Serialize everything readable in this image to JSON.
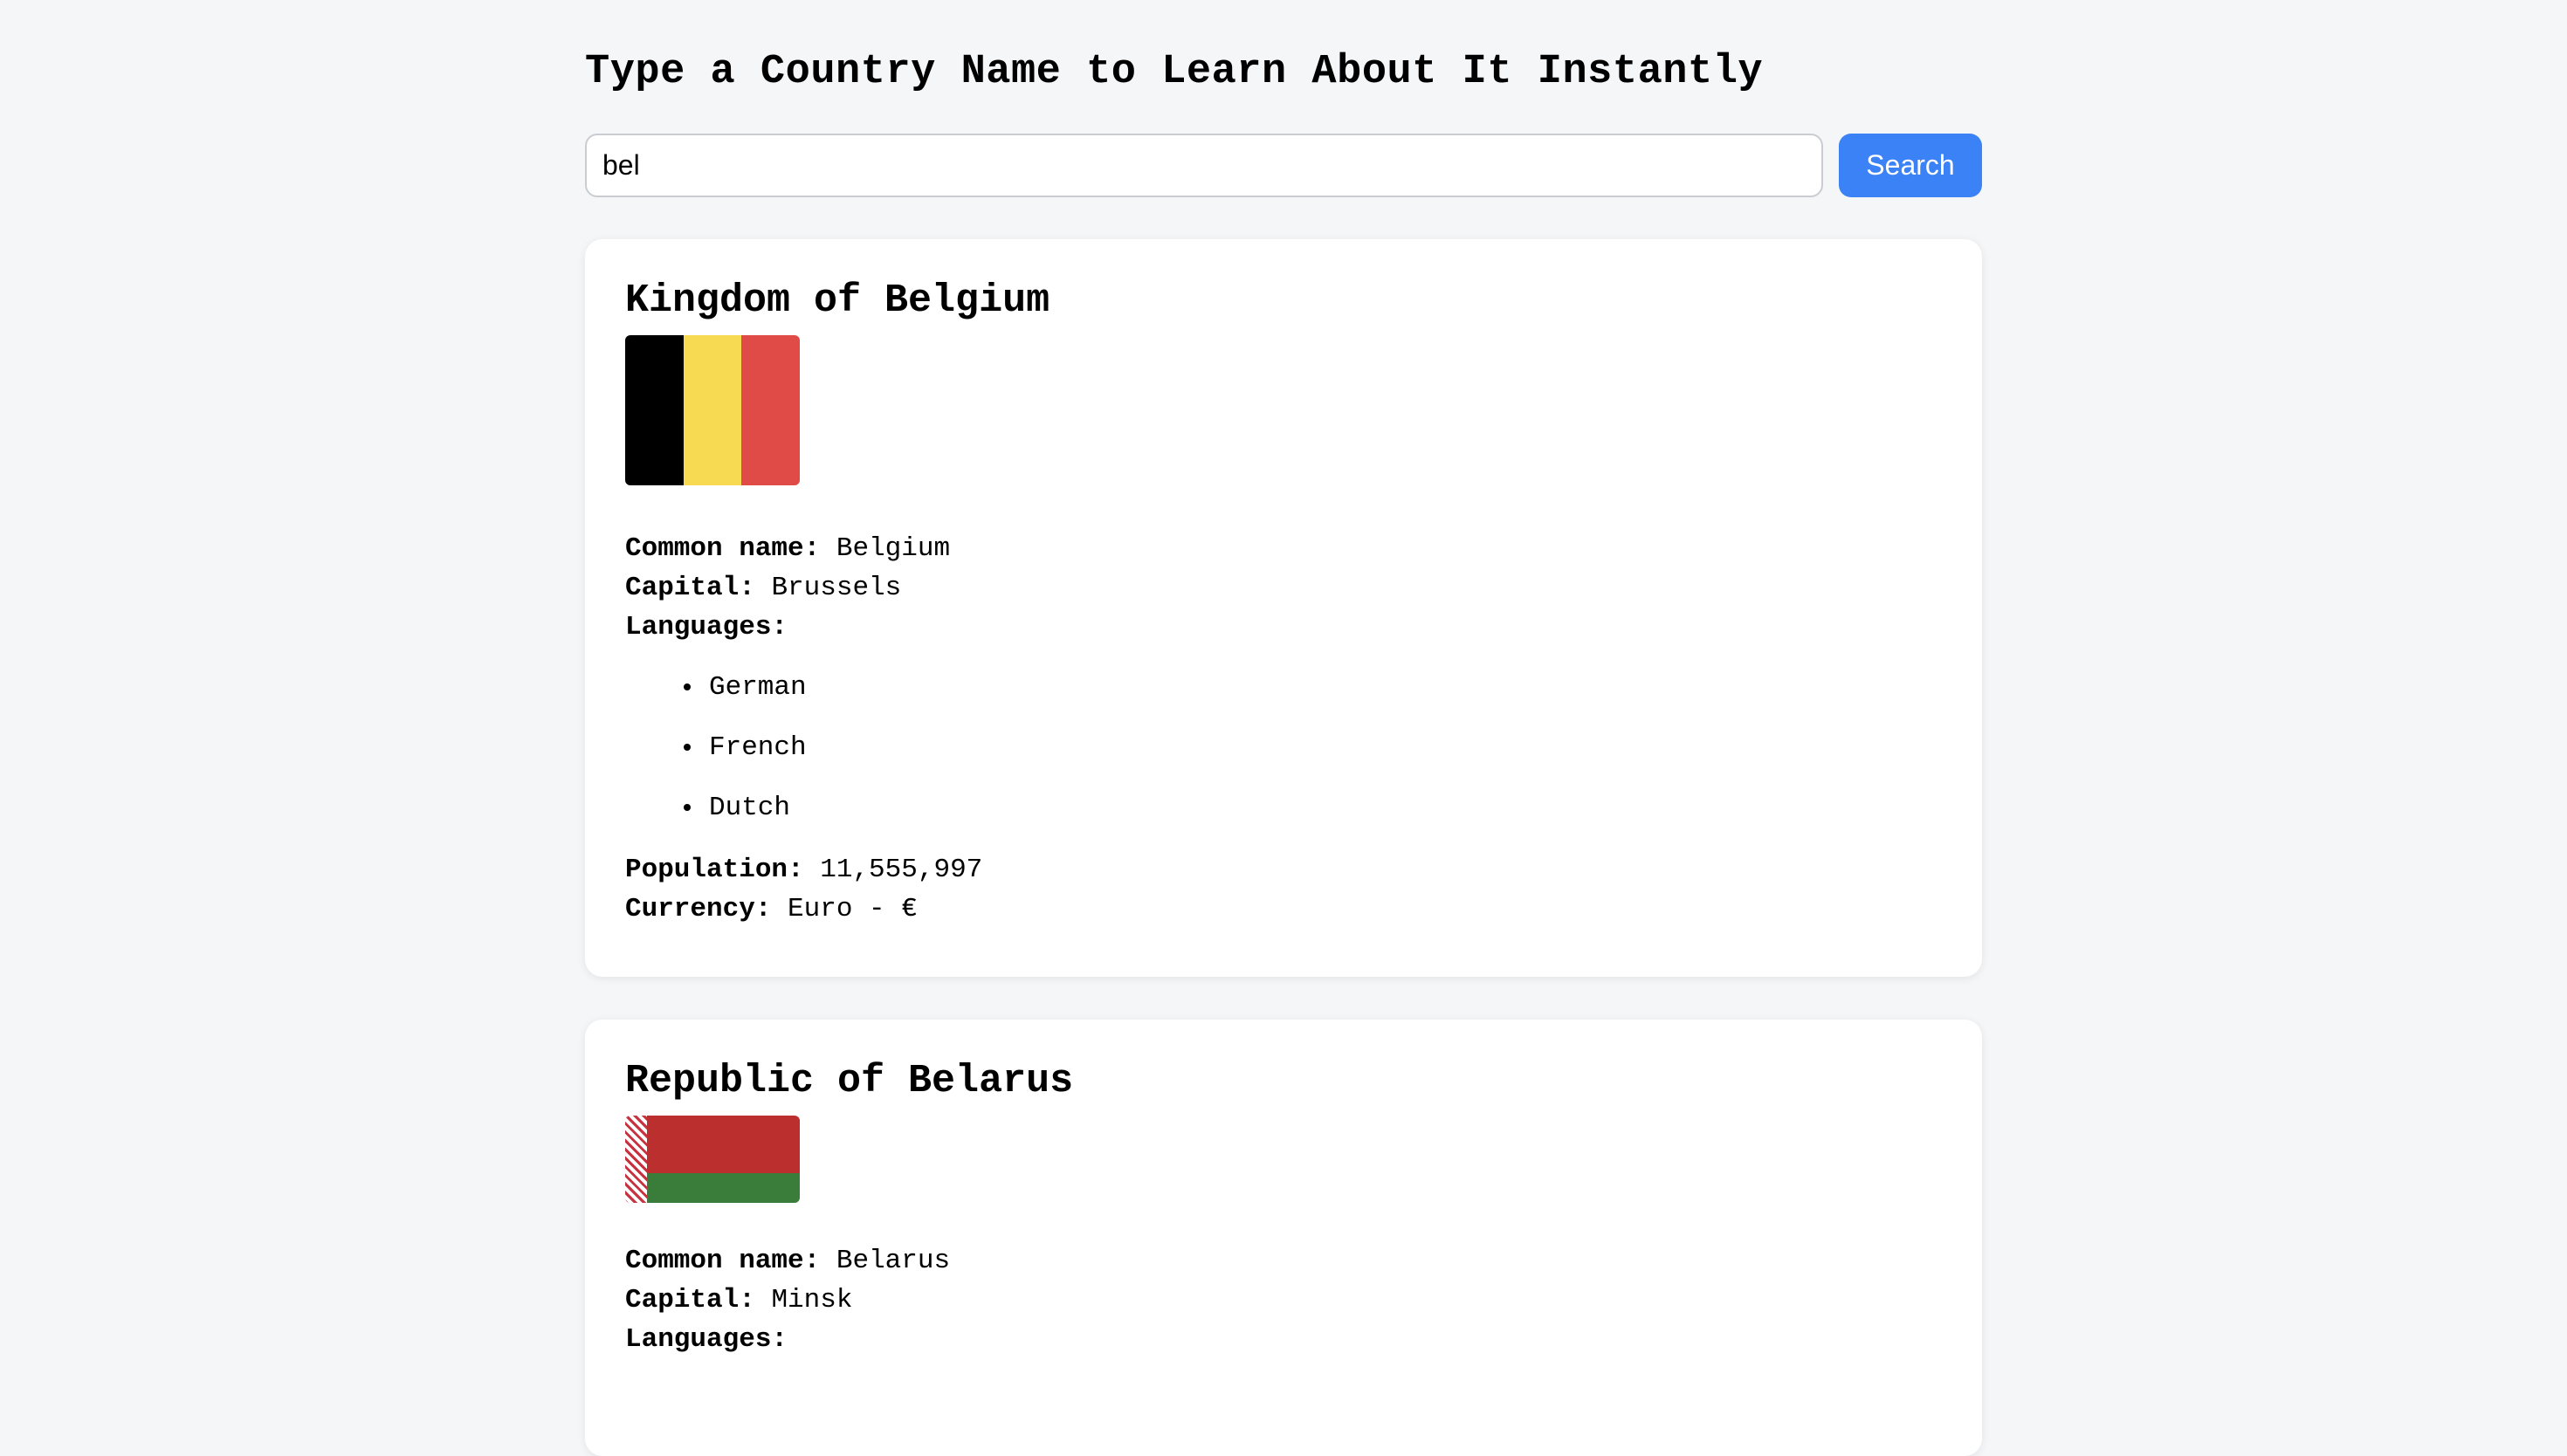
{
  "header": {
    "title": "Type a Country Name to Learn About It Instantly"
  },
  "search": {
    "value": "bel",
    "button_label": "Search"
  },
  "labels": {
    "common_name": "Common name:",
    "capital": "Capital:",
    "languages": "Languages:",
    "population": "Population:",
    "currency": "Currency:"
  },
  "results": [
    {
      "official_name": "Kingdom of Belgium",
      "flag_colors": [
        "#000000",
        "#f7da52",
        "#e04b48"
      ],
      "common_name": "Belgium",
      "capital": "Brussels",
      "languages": [
        "German",
        "French",
        "Dutch"
      ],
      "population": "11,555,997",
      "currency": "Euro - €"
    },
    {
      "official_name": "Republic of Belarus",
      "flag_colors": [
        "#bb2f2e",
        "#3a7d3b",
        "#ffffff"
      ],
      "common_name": "Belarus",
      "capital": "Minsk"
    }
  ]
}
